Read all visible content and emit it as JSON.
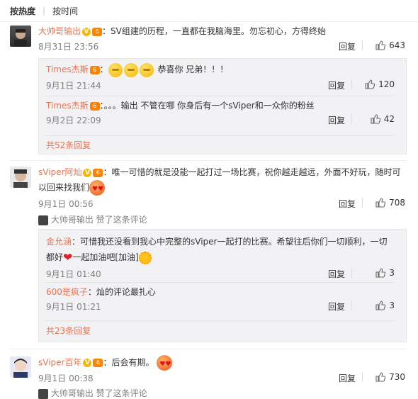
{
  "sort": {
    "hot": "按热度",
    "time": "按时间"
  },
  "comments": [
    {
      "user": "大帅哥输出",
      "text": "：SV组建的历程，一直都在我脑海里。勿忘初心，方得终始",
      "time": "8月31日 23:56",
      "reply": "回复",
      "likes": "643",
      "replies": [
        {
          "user": "Times杰斯",
          "text": "恭喜你 兄弟！！！",
          "time": "9月1日 21:44",
          "reply": "回复",
          "likes": "120"
        },
        {
          "user": "Times杰斯",
          "text": "：。。。输出 不管在哪 你身后有一个sViper和一众你的粉丝",
          "time": "9月2日 22:09",
          "reply": "回复",
          "likes": "42"
        }
      ],
      "more": "共52条回复"
    },
    {
      "user": "sViper阿灿",
      "text": "：唯一可惜的就是没能一起打过一场比赛，祝你越走越远，外面不好玩，随时可以回来找我们",
      "time": "9月1日 00:56",
      "liked_by": "大帅哥输出",
      "liked_suffix": "赞了这条评论",
      "reply": "回复",
      "likes": "708",
      "replies": [
        {
          "user": "金允涵",
          "text": "：可惜我还没看到我心中完整的sViper一起打的比赛。希望往后你们一切顺利，一切都好",
          "text2": "一起加油吧[加油]",
          "time": "9月1日 01:40",
          "reply": "回复",
          "likes": "3"
        },
        {
          "user": "600是疯子",
          "text": "：灿的评论最扎心",
          "time": "9月1日 01:21",
          "reply": "回复",
          "likes": "3"
        }
      ],
      "more": "共23条回复"
    },
    {
      "user": "sViper百年",
      "text": "：后会有期。",
      "time": "9月1日 00:38",
      "liked_by": "大帅哥输出",
      "liked_suffix": "赞了这条评论",
      "reply": "回复",
      "likes": "730"
    }
  ],
  "colors": {
    "username": "#eb7350",
    "subbox": "#f2f2f5",
    "vip": "#f7b500"
  }
}
